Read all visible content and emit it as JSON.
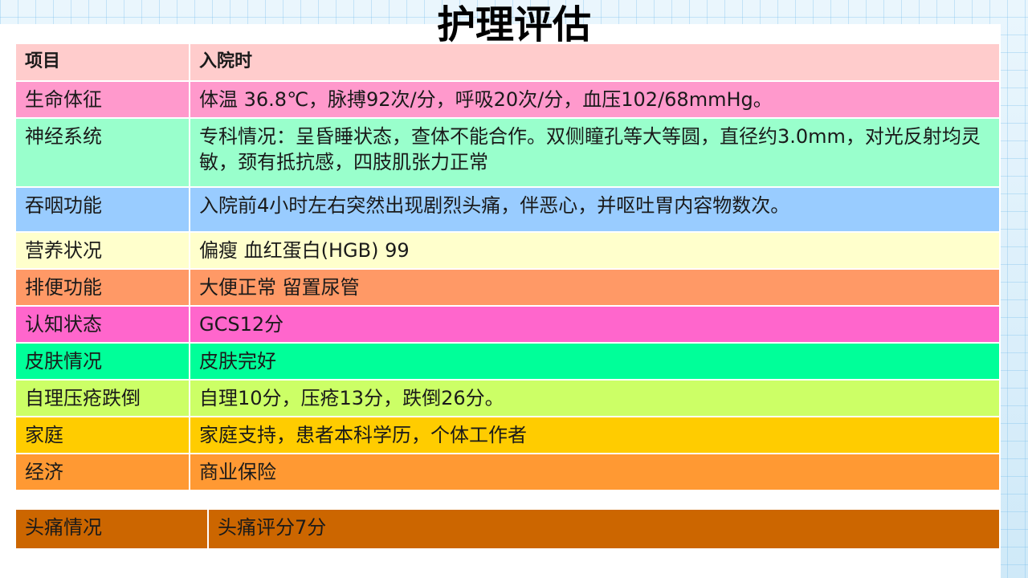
{
  "title": "护理评估",
  "table": {
    "header": {
      "item": "项目",
      "admission": "入院时"
    },
    "rows": [
      {
        "item": "生命体征",
        "value": "体温 36.8℃，脉搏92次/分，呼吸20次/分，血压102/68mmHg。"
      },
      {
        "item": "神经系统",
        "value": "专科情况：呈昏睡状态，查体不能合作。双侧瞳孔等大等圆，直径约3.0mm，对光反射均灵敏，颈有抵抗感，四肢肌张力正常"
      },
      {
        "item": "吞咽功能",
        "value": "入院前4小时左右突然出现剧烈头痛，伴恶心，并呕吐胃内容物数次。"
      },
      {
        "item": "营养状况",
        "value": "偏瘦 血红蛋白(HGB) 99"
      },
      {
        "item": "排便功能",
        "value": "大便正常 留置尿管"
      },
      {
        "item": "认知状态",
        "value": "GCS12分"
      },
      {
        "item": "皮肤情况",
        "value": "皮肤完好"
      },
      {
        "item": "自理压疮跌倒",
        "value": "自理10分，压疮13分，跌倒26分。"
      },
      {
        "item": "家庭",
        "value": "家庭支持，患者本科学历，个体工作者"
      },
      {
        "item": "经济",
        "value": "商业保险"
      },
      {
        "item": "头痛情况",
        "value": "头痛评分7分"
      }
    ]
  },
  "colors": {
    "header": "#ffcccc",
    "vital": "#ff99cc",
    "neuro": "#99ffcc",
    "swallow": "#99ccff",
    "nutrition": "#ffffcc",
    "excretion": "#ff9966",
    "cognition": "#ff66cc",
    "skin": "#00ff99",
    "self_care": "#ccff66",
    "family": "#ffcc00",
    "economy": "#ff9933",
    "pain": "#cc6600"
  }
}
